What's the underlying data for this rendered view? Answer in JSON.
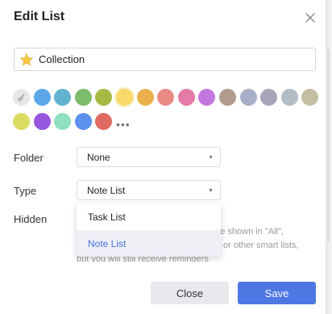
{
  "dialog": {
    "title": "Edit List"
  },
  "name_field": {
    "value": "Collection",
    "icon": "star-icon"
  },
  "colors": {
    "row1": [
      "none",
      "#5aa6e8",
      "#62b3d0",
      "#7cbc6a",
      "#a4ba44",
      "#f7d96a",
      "#eab04c",
      "#e98b84",
      "#e47ba6",
      "#c476e0",
      "#b19b8c",
      "#a8b0c9",
      "#a9a5b8",
      "#b1bcc4",
      "#c4bea4"
    ],
    "row2": [
      "#dcdb62",
      "#9555df",
      "#8ee0bf",
      "#5b90ee",
      "#df6a60"
    ],
    "selected_index": 5,
    "more": "•••"
  },
  "folder": {
    "label": "Folder",
    "value": "None"
  },
  "type": {
    "label": "Type",
    "value": "Note List",
    "options": [
      {
        "label": "Task List",
        "active": false
      },
      {
        "label": "Note List",
        "active": true
      }
    ]
  },
  "hidden": {
    "label": "Hidden",
    "lines": [
      "t be shown in \"All\",",
      "or other smart lists,",
      "but you will still receive reminders"
    ]
  },
  "buttons": {
    "close": "Close",
    "save": "Save"
  }
}
